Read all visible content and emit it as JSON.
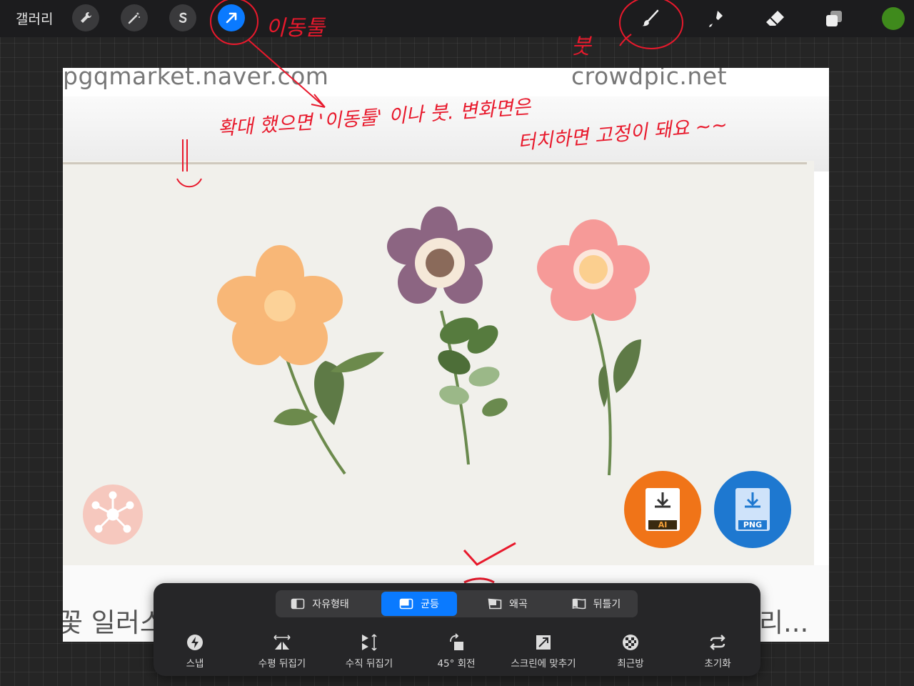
{
  "topbar": {
    "gallery_label": "갤러리",
    "tools_left": [
      "wrench-icon",
      "magic-wand-icon",
      "selection-s-icon",
      "move-arrow-icon"
    ],
    "tools_right": [
      "brush-icon",
      "smudge-icon",
      "eraser-icon",
      "layers-icon"
    ],
    "color": "#3f8a1c",
    "accent": "#0a7aff"
  },
  "canvas": {
    "source_left": "pgqmarket.naver.com",
    "source_right": "crowdpic.net",
    "caption_left": "꽃 일러스",
    "caption_right": "리...",
    "badges": [
      "AI",
      "PNG"
    ]
  },
  "annotations": {
    "move_tool": "이동툴",
    "brush": "붓",
    "note_line1": "확대 했으면 '이동툴' 이나   붓. 변화면은",
    "note_line2": "터치하면  고정이 돼요 ~~",
    "colors": {
      "ink": "#e8192c"
    }
  },
  "transform_toolbar": {
    "modes": [
      {
        "label": "자유형태",
        "active": false
      },
      {
        "label": "균등",
        "active": true
      },
      {
        "label": "왜곡",
        "active": false
      },
      {
        "label": "뒤틀기",
        "active": false
      }
    ],
    "buttons": [
      {
        "label": "스냅",
        "icon": "snap-bolt-icon"
      },
      {
        "label": "수평 뒤집기",
        "icon": "flip-horizontal-icon"
      },
      {
        "label": "수직 뒤집기",
        "icon": "flip-vertical-icon"
      },
      {
        "label": "45° 회전",
        "icon": "rotate-45-icon"
      },
      {
        "label": "스크린에 맞추기",
        "icon": "fit-screen-icon"
      },
      {
        "label": "최근방",
        "icon": "nearest-neighbor-icon"
      },
      {
        "label": "초기화",
        "icon": "reset-icon"
      }
    ]
  }
}
